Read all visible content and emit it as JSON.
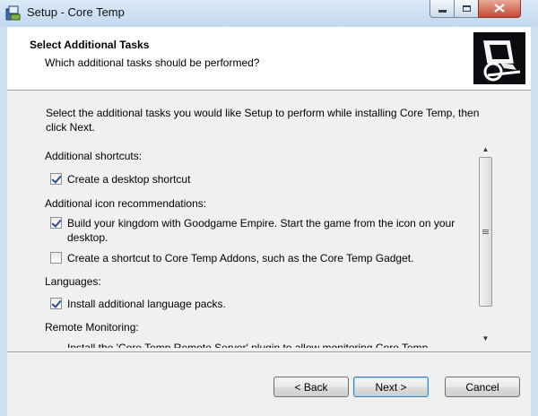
{
  "window": {
    "title": "Setup - Core Temp",
    "icon": "setup-icon"
  },
  "header": {
    "title": "Select Additional Tasks",
    "subtitle": "Which additional tasks should be performed?"
  },
  "content": {
    "description": "Select the additional tasks you would like Setup to perform while installing Core Temp, then click Next.",
    "sections": [
      {
        "label": "Additional shortcuts:"
      },
      {
        "label": "Additional icon recommendations:"
      },
      {
        "label": "Languages:"
      },
      {
        "label": "Remote Monitoring:"
      }
    ],
    "tasks": [
      {
        "label": "Create a desktop shortcut",
        "checked": true
      },
      {
        "label": "Build your kingdom with Goodgame Empire. Start the game from the icon on your desktop.",
        "checked": true
      },
      {
        "label": "Create a shortcut to Core Temp Addons, such as the Core Temp Gadget.",
        "checked": false
      },
      {
        "label": "Install additional language packs.",
        "checked": true
      }
    ],
    "partial_text": "Install the 'Core Temp Remote Server' plugin to allow monitoring Core Temp"
  },
  "buttons": {
    "back": "< Back",
    "next": "Next >",
    "cancel": "Cancel"
  }
}
